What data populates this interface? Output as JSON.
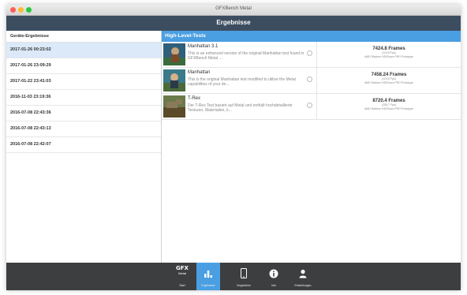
{
  "window": {
    "title": "GFXBench Metal"
  },
  "navbar": {
    "title": "Ergebnisse"
  },
  "sidebar": {
    "header": "Geräte-Ergebnisse",
    "items": [
      {
        "label": "2017-01-26 00:23:02"
      },
      {
        "label": "2017-01-26 23:09:29"
      },
      {
        "label": "2017-01-22 23:41:03"
      },
      {
        "label": "2016-11-03 23:19:36"
      },
      {
        "label": "2016-07-08 22:43:36"
      },
      {
        "label": "2016-07-08 22:43:13"
      },
      {
        "label": "2016-07-08 22:42:07"
      }
    ]
  },
  "main": {
    "section": "High-Level-Tests",
    "tests": [
      {
        "name": "Manhattan 3.1",
        "desc": "This is an enhanced version of the original Manhattan test found in GFXBench Metal ...",
        "result": "7424.8 Frames",
        "sub1": "(119,8 Fps)",
        "sub2": "AMD Radeon HD/Room PRO Prototype"
      },
      {
        "name": "Manhattan",
        "desc": "This is the original Manhattan test modified to utilize the Metal capabilities of your de...",
        "result": "7458.24 Frames",
        "sub1": "(119,6 Fps)",
        "sub2": "AMD Radeon HD/Room PRO Prototype"
      },
      {
        "name": "T-Rex",
        "desc": "Der T-Rex Test basiert auf Metal und enthält hochdetaillierte Texturen, Materialien, k...",
        "result": "8720.4 Frames",
        "sub1": "(155,7 Fps)",
        "sub2": "AMD Radeon HD/Room PRO Prototype"
      }
    ]
  },
  "tabbar": {
    "logo_top": "GFX",
    "logo_bottom": "Metal",
    "items": [
      {
        "label": "Start"
      },
      {
        "label": "Ergebnisse"
      },
      {
        "label": "Vergleichen"
      },
      {
        "label": "Info"
      },
      {
        "label": "Einstellungen"
      }
    ]
  }
}
